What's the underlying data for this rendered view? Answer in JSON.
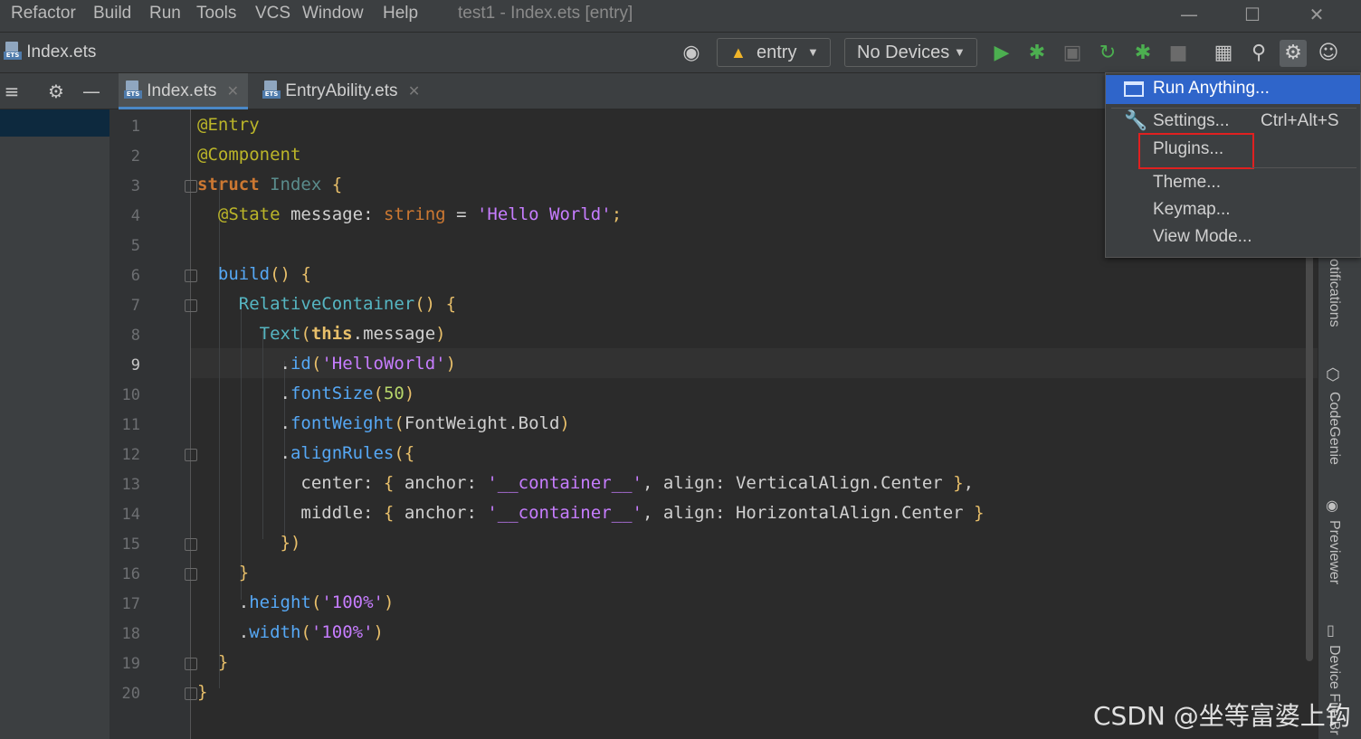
{
  "menubar": {
    "items": [
      "Refactor",
      "Build",
      "Run",
      "Tools",
      "VCS",
      "Window",
      "Help"
    ],
    "window_title": "test1 - Index.ets [entry]"
  },
  "toolbar": {
    "nav_file": "Index.ets",
    "module_combo": "entry",
    "device_combo": "No Devices"
  },
  "tabs": [
    {
      "label": "Index.ets",
      "active": true
    },
    {
      "label": "EntryAbility.ets",
      "active": false
    }
  ],
  "editor": {
    "current_line": 9,
    "line_numbers": [
      "1",
      "2",
      "3",
      "4",
      "5",
      "6",
      "7",
      "8",
      "9",
      "10",
      "11",
      "12",
      "13",
      "14",
      "15",
      "16",
      "17",
      "18",
      "19",
      "20"
    ]
  },
  "popup_menu": {
    "run_anything": "Run Anything...",
    "settings": "Settings...",
    "settings_shortcut": "Ctrl+Alt+S",
    "plugins": "Plugins...",
    "theme": "Theme...",
    "keymap": "Keymap...",
    "view_mode": "View Mode..."
  },
  "right_panel": {
    "notifications": "otifications",
    "codegenie": "CodeGenie",
    "previewer": "Previewer",
    "device": "Device File Br"
  },
  "watermark": "CSDN @坐等富婆上钩",
  "colors": {
    "accent": "#2f65ca",
    "highlight_box": "#e02020",
    "run_green": "#4caf50"
  }
}
